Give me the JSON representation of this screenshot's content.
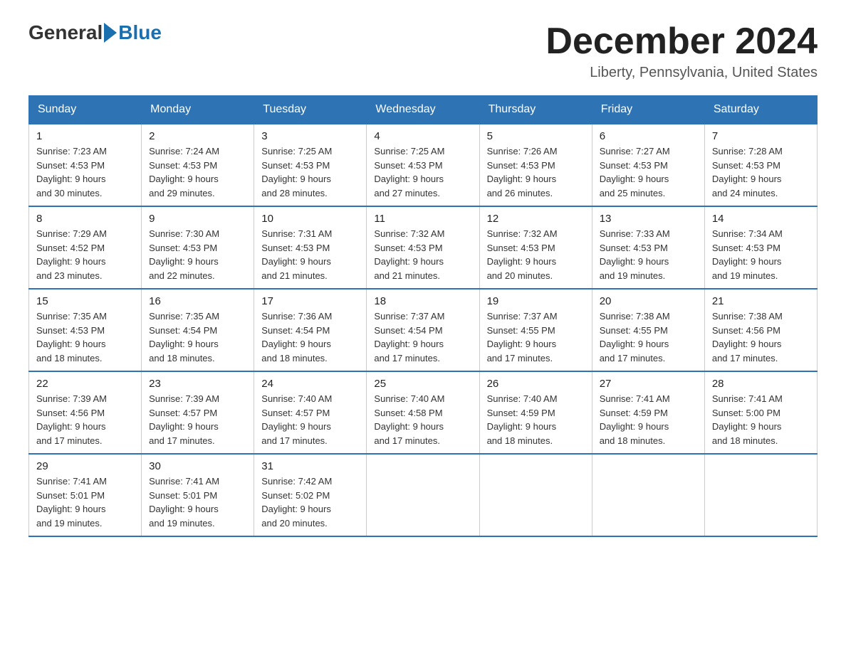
{
  "header": {
    "logo_general": "General",
    "logo_blue": "Blue",
    "month_title": "December 2024",
    "location": "Liberty, Pennsylvania, United States"
  },
  "weekdays": [
    "Sunday",
    "Monday",
    "Tuesday",
    "Wednesday",
    "Thursday",
    "Friday",
    "Saturday"
  ],
  "weeks": [
    [
      {
        "day": "1",
        "sunrise": "7:23 AM",
        "sunset": "4:53 PM",
        "daylight": "9 hours and 30 minutes."
      },
      {
        "day": "2",
        "sunrise": "7:24 AM",
        "sunset": "4:53 PM",
        "daylight": "9 hours and 29 minutes."
      },
      {
        "day": "3",
        "sunrise": "7:25 AM",
        "sunset": "4:53 PM",
        "daylight": "9 hours and 28 minutes."
      },
      {
        "day": "4",
        "sunrise": "7:25 AM",
        "sunset": "4:53 PM",
        "daylight": "9 hours and 27 minutes."
      },
      {
        "day": "5",
        "sunrise": "7:26 AM",
        "sunset": "4:53 PM",
        "daylight": "9 hours and 26 minutes."
      },
      {
        "day": "6",
        "sunrise": "7:27 AM",
        "sunset": "4:53 PM",
        "daylight": "9 hours and 25 minutes."
      },
      {
        "day": "7",
        "sunrise": "7:28 AM",
        "sunset": "4:53 PM",
        "daylight": "9 hours and 24 minutes."
      }
    ],
    [
      {
        "day": "8",
        "sunrise": "7:29 AM",
        "sunset": "4:52 PM",
        "daylight": "9 hours and 23 minutes."
      },
      {
        "day": "9",
        "sunrise": "7:30 AM",
        "sunset": "4:53 PM",
        "daylight": "9 hours and 22 minutes."
      },
      {
        "day": "10",
        "sunrise": "7:31 AM",
        "sunset": "4:53 PM",
        "daylight": "9 hours and 21 minutes."
      },
      {
        "day": "11",
        "sunrise": "7:32 AM",
        "sunset": "4:53 PM",
        "daylight": "9 hours and 21 minutes."
      },
      {
        "day": "12",
        "sunrise": "7:32 AM",
        "sunset": "4:53 PM",
        "daylight": "9 hours and 20 minutes."
      },
      {
        "day": "13",
        "sunrise": "7:33 AM",
        "sunset": "4:53 PM",
        "daylight": "9 hours and 19 minutes."
      },
      {
        "day": "14",
        "sunrise": "7:34 AM",
        "sunset": "4:53 PM",
        "daylight": "9 hours and 19 minutes."
      }
    ],
    [
      {
        "day": "15",
        "sunrise": "7:35 AM",
        "sunset": "4:53 PM",
        "daylight": "9 hours and 18 minutes."
      },
      {
        "day": "16",
        "sunrise": "7:35 AM",
        "sunset": "4:54 PM",
        "daylight": "9 hours and 18 minutes."
      },
      {
        "day": "17",
        "sunrise": "7:36 AM",
        "sunset": "4:54 PM",
        "daylight": "9 hours and 18 minutes."
      },
      {
        "day": "18",
        "sunrise": "7:37 AM",
        "sunset": "4:54 PM",
        "daylight": "9 hours and 17 minutes."
      },
      {
        "day": "19",
        "sunrise": "7:37 AM",
        "sunset": "4:55 PM",
        "daylight": "9 hours and 17 minutes."
      },
      {
        "day": "20",
        "sunrise": "7:38 AM",
        "sunset": "4:55 PM",
        "daylight": "9 hours and 17 minutes."
      },
      {
        "day": "21",
        "sunrise": "7:38 AM",
        "sunset": "4:56 PM",
        "daylight": "9 hours and 17 minutes."
      }
    ],
    [
      {
        "day": "22",
        "sunrise": "7:39 AM",
        "sunset": "4:56 PM",
        "daylight": "9 hours and 17 minutes."
      },
      {
        "day": "23",
        "sunrise": "7:39 AM",
        "sunset": "4:57 PM",
        "daylight": "9 hours and 17 minutes."
      },
      {
        "day": "24",
        "sunrise": "7:40 AM",
        "sunset": "4:57 PM",
        "daylight": "9 hours and 17 minutes."
      },
      {
        "day": "25",
        "sunrise": "7:40 AM",
        "sunset": "4:58 PM",
        "daylight": "9 hours and 17 minutes."
      },
      {
        "day": "26",
        "sunrise": "7:40 AM",
        "sunset": "4:59 PM",
        "daylight": "9 hours and 18 minutes."
      },
      {
        "day": "27",
        "sunrise": "7:41 AM",
        "sunset": "4:59 PM",
        "daylight": "9 hours and 18 minutes."
      },
      {
        "day": "28",
        "sunrise": "7:41 AM",
        "sunset": "5:00 PM",
        "daylight": "9 hours and 18 minutes."
      }
    ],
    [
      {
        "day": "29",
        "sunrise": "7:41 AM",
        "sunset": "5:01 PM",
        "daylight": "9 hours and 19 minutes."
      },
      {
        "day": "30",
        "sunrise": "7:41 AM",
        "sunset": "5:01 PM",
        "daylight": "9 hours and 19 minutes."
      },
      {
        "day": "31",
        "sunrise": "7:42 AM",
        "sunset": "5:02 PM",
        "daylight": "9 hours and 20 minutes."
      },
      null,
      null,
      null,
      null
    ]
  ],
  "labels": {
    "sunrise": "Sunrise:",
    "sunset": "Sunset:",
    "daylight": "Daylight:"
  }
}
